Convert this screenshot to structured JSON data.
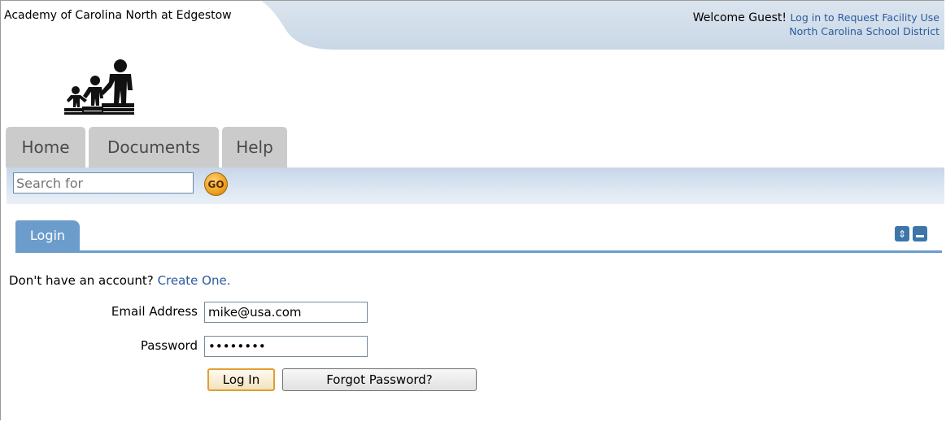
{
  "header": {
    "school_name": "Academy of Carolina North at Edgestow",
    "welcome_text": "Welcome Guest!",
    "login_link": "Log in to Request Facility Use",
    "district_link": "North Carolina School District"
  },
  "logo_icon": "family-logo",
  "tabs": [
    {
      "label": "Home"
    },
    {
      "label": "Documents"
    },
    {
      "label": "Help"
    }
  ],
  "search": {
    "placeholder": "Search for",
    "go_label": "GO"
  },
  "login": {
    "tab_label": "Login",
    "no_account_text": "Don't have an account?",
    "create_link": "Create One.",
    "email_label": "Email Address",
    "email_value": "mike@usa.com",
    "password_label": "Password",
    "password_value": "mikepass",
    "login_button": "Log In",
    "forgot_button": "Forgot Password?"
  },
  "colors": {
    "accent": "#6b9ccc",
    "link": "#2a5b9d",
    "go_button": "#f0a020"
  }
}
